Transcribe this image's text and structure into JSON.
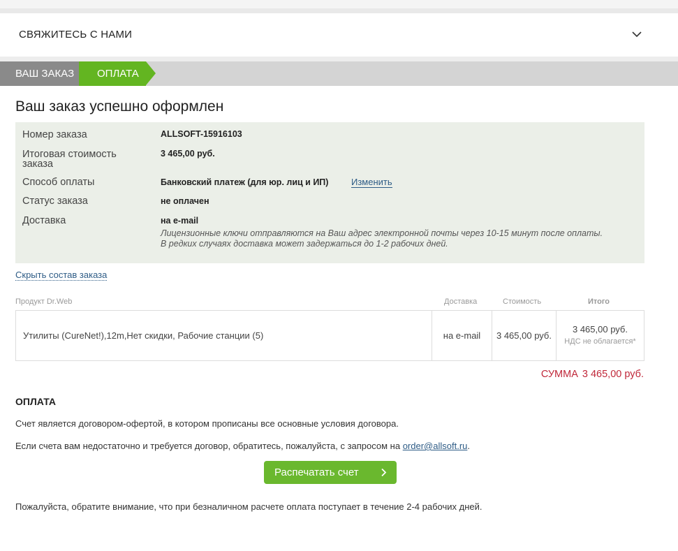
{
  "contact": {
    "title": "СВЯЖИТЕСЬ С НАМИ"
  },
  "steps": [
    {
      "label": "ВАШ ЗАКАЗ"
    },
    {
      "label": "ОПЛАТА"
    }
  ],
  "heading": "Ваш заказ успешно оформлен",
  "order_info": {
    "number_label": "Номер заказа",
    "number_value": "ALLSOFT-15916103",
    "total_label_line1": "Итоговая стоимость",
    "total_label_line2": "заказа",
    "total_value": "3 465,00 руб.",
    "payment_label": "Способ оплаты",
    "payment_value": "Банковский платеж (для юр. лиц и ИП)",
    "change_link": "Изменить",
    "status_label": "Статус заказа",
    "status_value": "не оплачен",
    "delivery_label": "Доставка",
    "delivery_value": "на e-mail",
    "delivery_note_line1": "Лицензионные ключи отправляются на Ваш адрес электронной почты через 10-15 минут после оплаты.",
    "delivery_note_line2": "В редких случаях доставка может задержаться до 1-2 рабочих дней."
  },
  "toggle_link": "Скрыть состав заказа",
  "table": {
    "headers": {
      "product": "Продукт Dr.Web",
      "delivery": "Доставка",
      "price": "Стоимость",
      "total": "Итого"
    },
    "rows": [
      {
        "product": "Утилиты (CureNet!),12m,Нет скидки, Рабочие станции (5)",
        "delivery": "на e-mail",
        "price": "3 465,00 руб.",
        "total": "3 465,00 руб.",
        "vat": "НДС не облагается*"
      }
    ]
  },
  "sum": {
    "label": "СУММА",
    "value": "3 465,00 руб."
  },
  "payment_section": {
    "title": "ОПЛАТА",
    "text1": "Счет является договором-офертой, в котором прописаны все основные условия договора.",
    "text2_before": "Если счета вам недостаточно и требуется договор, обратитесь, пожалуйста, с запросом на ",
    "email": "order@allsoft.ru",
    "text2_after": ".",
    "print_button": "Распечатать счет",
    "text3": "Пожалуйста, обратите внимание, что при безналичном расчете оплата поступает в течение 2-4 рабочих дней."
  },
  "colors": {
    "accent_green": "#63b521",
    "step_gray": "#8a8a8a",
    "sum_red": "#c0283a",
    "link_blue": "#2e5c86",
    "info_bg": "#ebefe8"
  }
}
